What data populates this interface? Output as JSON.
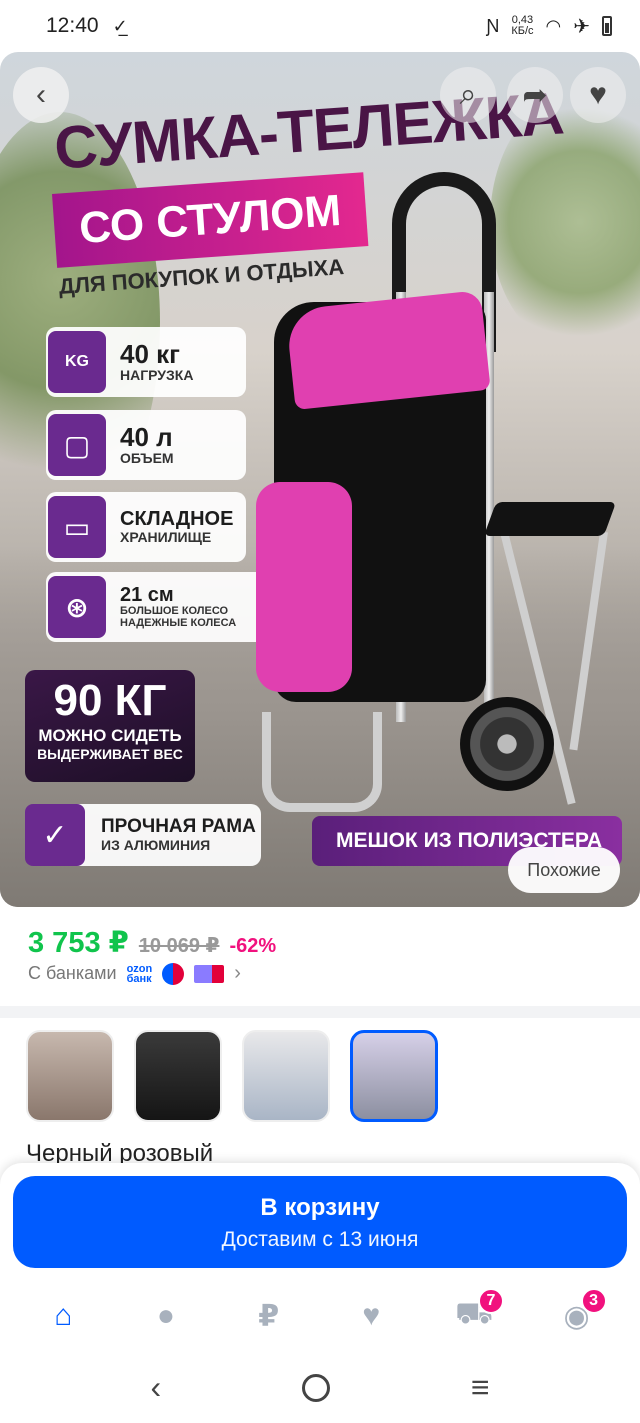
{
  "status_bar": {
    "time": "12:40",
    "left_icon": "download-done-icon",
    "nfc_icon": "nfc-icon",
    "net_speed_value": "0,43",
    "net_speed_unit": "КБ/с",
    "wifi_icon": "wifi-icon",
    "airplane_icon": "airplane-icon",
    "battery_icon": "battery-icon"
  },
  "hero": {
    "promo_title": "СУМКА-ТЕЛЕЖКА",
    "promo_sub": "СО СТУЛОМ",
    "promo_tag": "ДЛЯ ПОКУПОК И ОТДЫХА",
    "features": [
      {
        "icon_text": "KG",
        "big": "40 кг",
        "small": "НАГРУЗКА"
      },
      {
        "icon_text": "▢",
        "big": "40 л",
        "small": "ОБЪЕМ"
      },
      {
        "icon_text": "▭",
        "big": "СКЛАДНОЕ",
        "small": "ХРАНИЛИЩЕ"
      },
      {
        "icon_text": "⊛",
        "big": "21 см",
        "small": "БОЛЬШОЕ КОЛЕСО",
        "small2": "НАДЕЖНЫЕ КОЛЕСА"
      }
    ],
    "badge90": {
      "big": "90 КГ",
      "line1": "МОЖНО СИДЕТЬ",
      "line2": "ВЫДЕРЖИВАЕТ ВЕС"
    },
    "frame": {
      "big": "ПРОЧНАЯ РАМА",
      "small": "ИЗ АЛЮМИНИЯ"
    },
    "poly": "МЕШОК ИЗ ПОЛИЭСТЕРА",
    "similar_label": "Похожие"
  },
  "price": {
    "current": "3 753 ₽",
    "old": "10 069 ₽",
    "discount": "-62%",
    "bank_label": "С банками",
    "ozon_bank_line1": "ozon",
    "ozon_bank_line2": "банк"
  },
  "variants": {
    "selected_name": "Черный розовый",
    "count": 4
  },
  "cart_button": {
    "label": "В корзину",
    "delivery": "Доставим с 13 июня"
  },
  "bottom_nav": {
    "items": [
      {
        "name": "home",
        "icon": "⌂",
        "badge": ""
      },
      {
        "name": "fresh",
        "icon": "●",
        "badge": ""
      },
      {
        "name": "finance",
        "icon": "₽",
        "badge": ""
      },
      {
        "name": "favorites",
        "icon": "♥",
        "badge": ""
      },
      {
        "name": "cart",
        "icon": "🧺",
        "badge": "7"
      },
      {
        "name": "profile",
        "icon": "◉",
        "badge": "3"
      }
    ]
  },
  "colors": {
    "accent": "#005bff",
    "price_green": "#10c44c",
    "discount_pink": "#f1117e"
  }
}
